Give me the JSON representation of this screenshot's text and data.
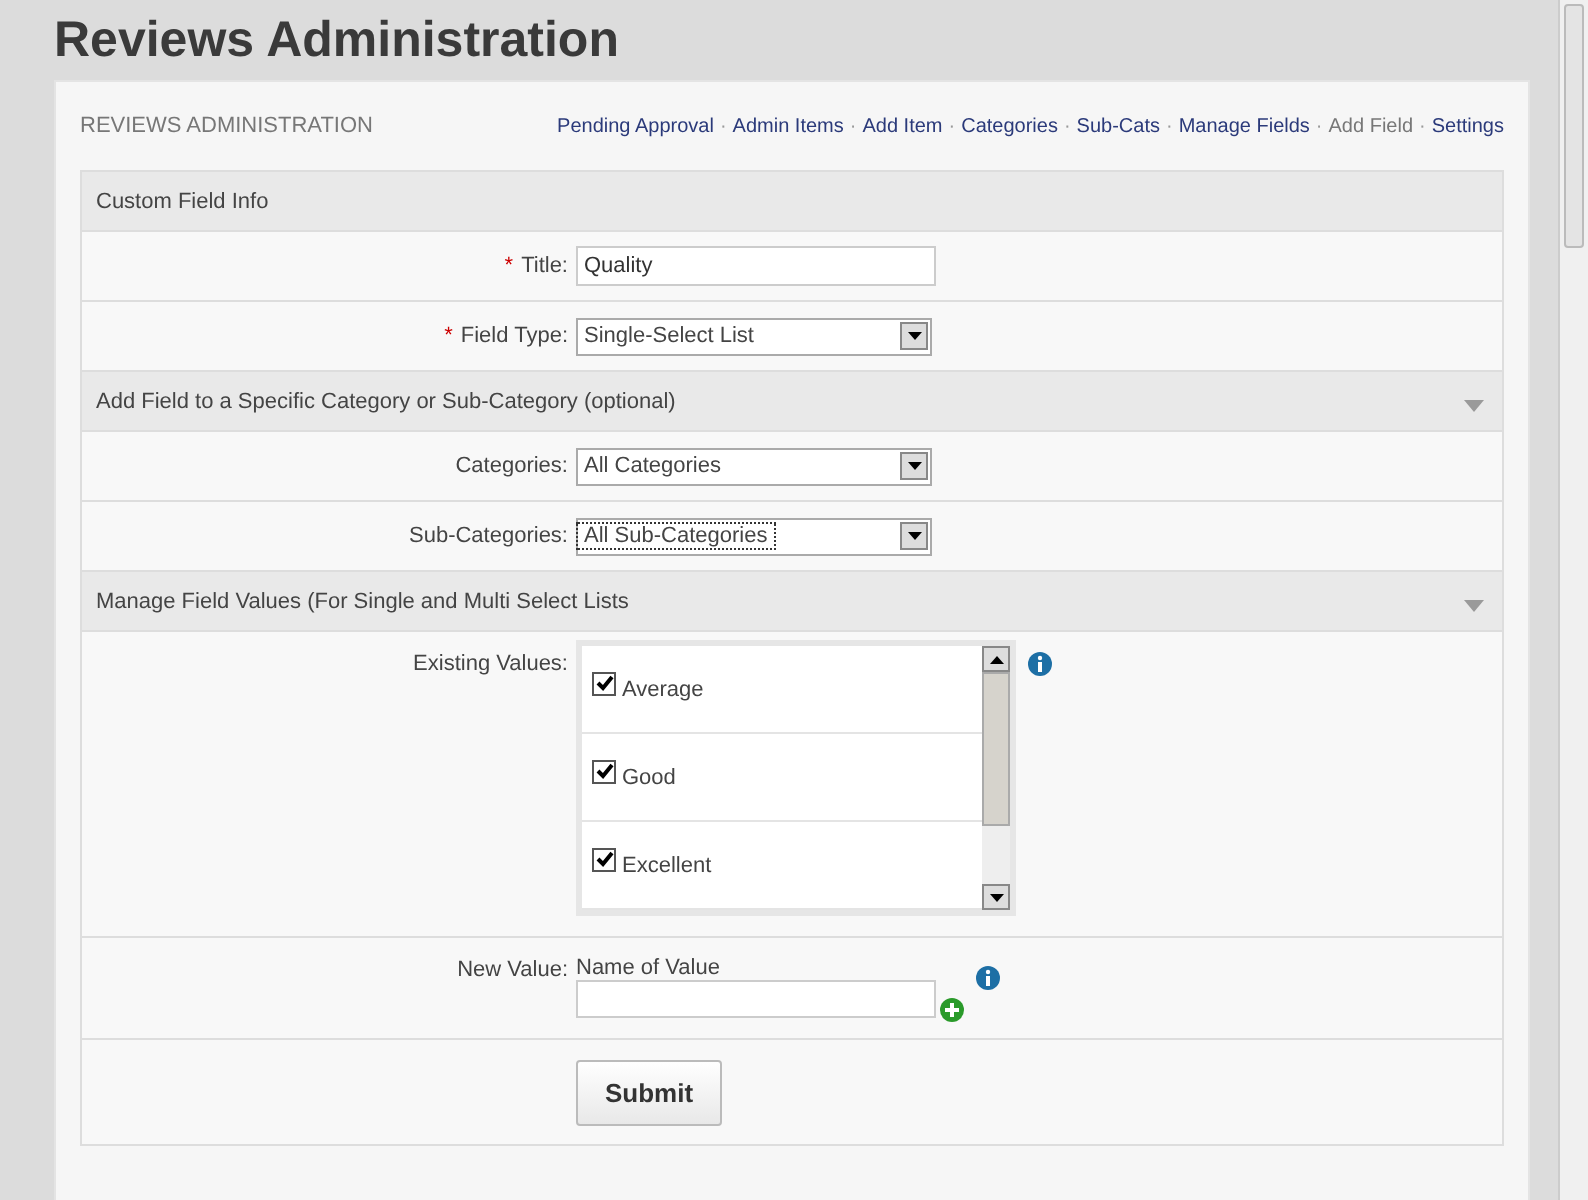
{
  "page_title": "Reviews Administration",
  "panel": {
    "heading": "REVIEWS ADMINISTRATION",
    "nav_separator": "·",
    "nav": [
      {
        "label": "Pending Approval",
        "selected": false
      },
      {
        "label": "Admin Items",
        "selected": false
      },
      {
        "label": "Add Item",
        "selected": false
      },
      {
        "label": "Categories",
        "selected": false
      },
      {
        "label": "Sub-Cats",
        "selected": false
      },
      {
        "label": "Manage Fields",
        "selected": false
      },
      {
        "label": "Add Field",
        "selected": true
      },
      {
        "label": "Settings",
        "selected": false
      }
    ]
  },
  "sections": [
    {
      "header": "Custom Field Info",
      "collapsible": false,
      "rows": [
        {
          "kind": "text",
          "label": "Title:",
          "required_mark": "*",
          "value": "Quality"
        },
        {
          "kind": "select",
          "label": "Field Type:",
          "required_mark": "*",
          "value": "Single-Select List",
          "focused": false
        }
      ]
    },
    {
      "header": "Add Field to a Specific Category or Sub-Category (optional)",
      "collapsible": true,
      "rows": [
        {
          "kind": "select",
          "label": "Categories:",
          "value": "All Categories",
          "focused": false
        },
        {
          "kind": "select",
          "label": "Sub-Categories:",
          "value": "All Sub-Categories",
          "focused": true
        }
      ]
    },
    {
      "header": "Manage Field Values (For Single and Multi Select Lists",
      "collapsible": true,
      "rows": [
        {
          "kind": "checklist",
          "label": "Existing Values:",
          "items": [
            {
              "label": "Average",
              "checked": true
            },
            {
              "label": "Good",
              "checked": true
            },
            {
              "label": "Excellent",
              "checked": true
            }
          ]
        },
        {
          "kind": "new_value",
          "label": "New Value:",
          "caption": "Name of Value"
        },
        {
          "kind": "submit",
          "button": "Submit"
        }
      ]
    }
  ]
}
